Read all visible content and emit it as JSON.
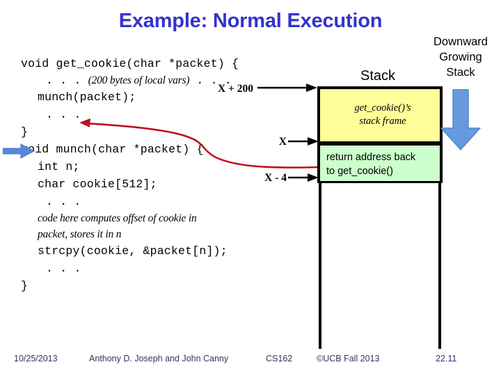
{
  "slide": {
    "title": "Example: Normal Execution"
  },
  "code": {
    "lines": [
      {
        "indent": 0,
        "text": "void get_cookie(char *packet) {",
        "style": "mono"
      },
      {
        "indent": 1,
        "pre_dots": ". . . ",
        "text": "(200 bytes of local vars)",
        "post_dots": " . . .",
        "style": "comment"
      },
      {
        "indent": 1,
        "text": "munch(packet);",
        "style": "mono"
      },
      {
        "indent": 1,
        "text": ". . .",
        "style": "mono"
      },
      {
        "indent": 0,
        "text": "}",
        "style": "mono"
      },
      {
        "indent": 0,
        "text": "void munch(char *packet) {",
        "style": "mono"
      },
      {
        "indent": 1,
        "text": "int n;",
        "style": "mono"
      },
      {
        "indent": 1,
        "text": "char cookie[512];",
        "style": "mono"
      },
      {
        "indent": 1,
        "text": ". . .",
        "style": "mono"
      },
      {
        "indent": 1,
        "text": "code here computes offset of cookie in",
        "style": "comment-plain"
      },
      {
        "indent": 1,
        "text": "packet, stores it in n",
        "style": "comment-plain"
      },
      {
        "indent": 1,
        "text": "strcpy(cookie, &packet[n]);",
        "style": "mono"
      },
      {
        "indent": 1,
        "text": ". . .",
        "style": "mono"
      },
      {
        "indent": 0,
        "text": "}",
        "style": "mono"
      }
    ]
  },
  "stack": {
    "label": "Stack",
    "frame_text_line1": "get_cookie()’s",
    "frame_text_line2": "stack frame",
    "retaddr_text_line1": "return address back",
    "retaddr_text_line2": "to get_cookie()",
    "frame_color": "#ffff99",
    "retaddr_color": "#ccffcc",
    "addresses": {
      "top": "X + 200",
      "middle": "X",
      "bottom": "X - 4"
    }
  },
  "annotations": {
    "downward_line1": "Downward",
    "downward_line2": "Growing",
    "downward_line3": "Stack",
    "arrow_color": "#6699dd",
    "call_arrow_color": "#bb1122",
    "pointer_color": "#5588dd"
  },
  "footer": {
    "date": "10/25/2013",
    "authors": "Anthony D. Joseph and John Canny",
    "course": "CS162",
    "copyright": "©UCB Fall 2013",
    "page": "22.11"
  }
}
